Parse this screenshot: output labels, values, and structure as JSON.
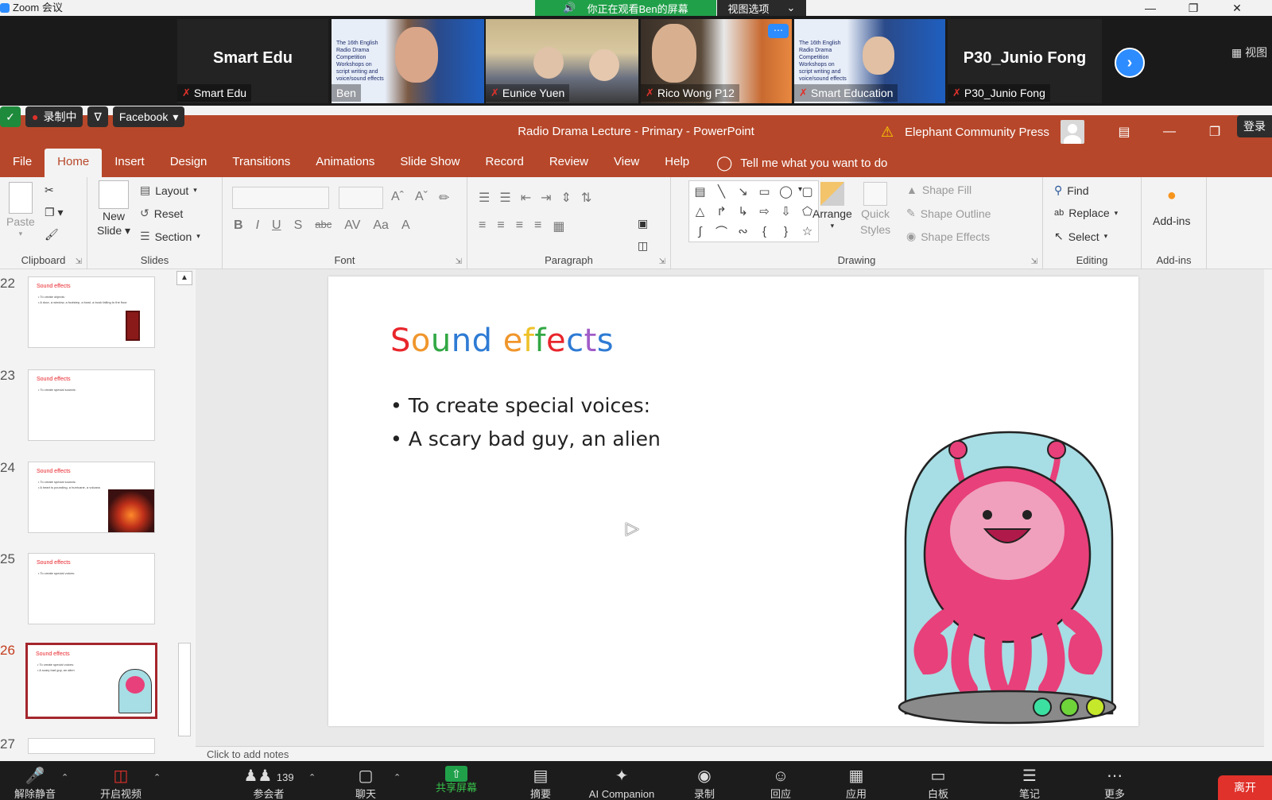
{
  "zoom": {
    "window_title": "Zoom 会议",
    "viewing_banner": "你正在观看Ben的屏幕",
    "view_options": "视图选项",
    "view_button": "视图",
    "participants": [
      {
        "display": "Smart Edu",
        "label": "Smart Edu",
        "video": false
      },
      {
        "label": "Ben",
        "video": true
      },
      {
        "label": "Eunice Yuen",
        "video": true
      },
      {
        "label": "Rico Wong P12",
        "video": true
      },
      {
        "label": "Smart Education",
        "video": true
      },
      {
        "display": "P30_Junio Fong",
        "label": "P30_Junio Fong",
        "video": false
      }
    ],
    "poster_text": "The 16th English Radio Drama Competition Workshops on script writing and voice/sound effects",
    "toolbar": {
      "unmute": "解除静音",
      "start_video": "开启视频",
      "participants": "参会者",
      "participant_count": "139",
      "chat": "聊天",
      "share_screen": "共享屏幕",
      "summary": "摘要",
      "ai_companion": "AI Companion",
      "record": "录制",
      "reactions": "回应",
      "apps": "应用",
      "whiteboard": "白板",
      "notes": "笔记",
      "more": "更多",
      "leave": "离开"
    }
  },
  "share_tools": {
    "recording": "录制中",
    "facebook": "Facebook"
  },
  "ppt": {
    "title": "Radio Drama Lecture - Primary  -  PowerPoint",
    "account": "Elephant Community Press",
    "login": "登录",
    "tabs": [
      "File",
      "Home",
      "Insert",
      "Design",
      "Transitions",
      "Animations",
      "Slide Show",
      "Record",
      "Review",
      "View",
      "Help"
    ],
    "tell_me": "Tell me what you want to do",
    "ribbon": {
      "clipboard": {
        "name": "Clipboard",
        "paste": "Paste"
      },
      "slides": {
        "name": "Slides",
        "new_slide_1": "New",
        "new_slide_2": "Slide",
        "layout": "Layout",
        "reset": "Reset",
        "section": "Section"
      },
      "font": {
        "name": "Font"
      },
      "paragraph": {
        "name": "Paragraph"
      },
      "drawing": {
        "name": "Drawing",
        "arrange": "Arrange",
        "quick_styles_1": "Quick",
        "quick_styles_2": "Styles",
        "shape_fill": "Shape Fill",
        "shape_outline": "Shape Outline",
        "shape_effects": "Shape Effects"
      },
      "editing": {
        "name": "Editing",
        "find": "Find",
        "replace": "Replace",
        "select": "Select"
      },
      "addins": {
        "name": "Add-ins",
        "button": "Add-ins"
      }
    },
    "thumbnails": [
      {
        "num": "22",
        "title": "Sound effects",
        "lines": [
          "• To create objects:",
          "• A door, a window, a footstep, a bowl, a book falling to the floor"
        ]
      },
      {
        "num": "23",
        "title": "Sound effects",
        "lines": [
          "• To create special sounds:"
        ]
      },
      {
        "num": "24",
        "title": "Sound effects",
        "lines": [
          "• To create special sounds:",
          "• A heart is pounding, a hurricane, a volcano"
        ]
      },
      {
        "num": "25",
        "title": "Sound effects",
        "lines": [
          "• To create special voices:"
        ]
      },
      {
        "num": "26",
        "title": "Sound effects",
        "lines": [
          "• To create special voices:",
          "• A scary bad guy, an alien"
        ]
      },
      {
        "num": "27"
      }
    ],
    "slide": {
      "title_letters": [
        "S",
        "o",
        "u",
        "n",
        "d",
        " ",
        "e",
        "f",
        "f",
        "e",
        "c",
        "t",
        "s"
      ],
      "title_colors": [
        "#e8262c",
        "#f0962c",
        "#32a844",
        "#2e7bd4",
        "#2e7bd4",
        "#ffffff",
        "#f0962c",
        "#eec22a",
        "#32a844",
        "#e8262c",
        "#2e7bd4",
        "#a05cc8",
        "#2e7bd4"
      ],
      "bullets": [
        "To create special voices:",
        "A scary bad guy, an alien"
      ]
    },
    "notes_placeholder": "Click to add notes"
  }
}
